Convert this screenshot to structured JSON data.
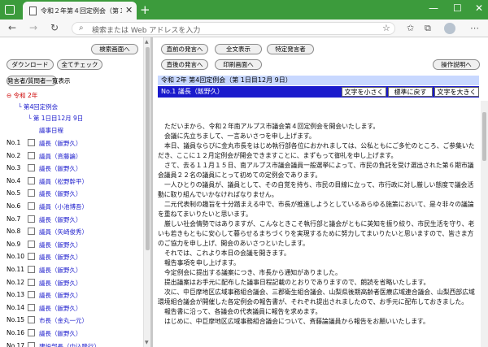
{
  "browser": {
    "tab_title": "令和２年第４回定例会（第１日目",
    "tab_close": "✕",
    "new_tab": "+",
    "back": "←",
    "forward": "→",
    "reload": "↻",
    "address_placeholder": "検索または Web アドレスを入力",
    "minimize": "—",
    "maximize": "☐",
    "close": "✕"
  },
  "left": {
    "buttons": {
      "search_screen": "検索画面へ",
      "download": "ダウンロード",
      "all_check": "全てチェック",
      "speaker_list": "発言者/質問者一覧表示"
    },
    "tree": {
      "year": "令和 2年",
      "session": "第4回定例会",
      "day": "第 1日目12月 9日",
      "agenda": "議事日程"
    },
    "rows": [
      {
        "no": "No.1",
        "speaker": "議長（飯野久）"
      },
      {
        "no": "No.2",
        "speaker": "議員（斉藤論）"
      },
      {
        "no": "No.3",
        "speaker": "議長（飯野久）"
      },
      {
        "no": "No.4",
        "speaker": "議員（松野幹平）"
      },
      {
        "no": "No.5",
        "speaker": "議長（飯野久）"
      },
      {
        "no": "No.6",
        "speaker": "議員（小池博吾）"
      },
      {
        "no": "No.7",
        "speaker": "議長（飯野久）"
      },
      {
        "no": "No.8",
        "speaker": "議員（矢崎俊秀）"
      },
      {
        "no": "No.9",
        "speaker": "議長（飯野久）"
      },
      {
        "no": "No.10",
        "speaker": "議長（飯野久）"
      },
      {
        "no": "No.11",
        "speaker": "議長（飯野久）"
      },
      {
        "no": "No.12",
        "speaker": "議長（飯野久）"
      },
      {
        "no": "No.13",
        "speaker": "議長（飯野久）"
      },
      {
        "no": "No.14",
        "speaker": "議長（飯野久）"
      },
      {
        "no": "No.15",
        "speaker": "市長（金丸一元）"
      },
      {
        "no": "No.16",
        "speaker": "議長（飯野久）"
      },
      {
        "no": "No.17",
        "speaker": "建設部長（中込隆行）"
      }
    ]
  },
  "right": {
    "buttons": {
      "prev_remark": "直前の発言へ",
      "full_text": "全文表示",
      "specific_speaker": "特定発言者",
      "next_remark": "直後の発言へ",
      "print_screen": "印刷画面へ",
      "operation_help": "操作説明へ"
    },
    "meeting_title": "令和 2年 第4回定例会（第 1日目12月 9日）",
    "speaker_label": "No.1 議長（飯野久）",
    "size_buttons": {
      "smaller": "文字を小さく",
      "standard": "標準に戻す",
      "larger": "文字を大きく"
    },
    "paragraphs": [
      "ただいまから、令和２年南アルプス市議会第４回定例会を開会いたします。",
      "会議に先立ちまして、一言あいさつを申し上げます。",
      "本日、議員ならびに金丸市長をはじめ執行部各位におかれましては、公私ともにご多忙のところ、ご参集いただき、ここに１２月定例会が開会できますことに、まずもって御礼を申し上げます。",
      "さて、去る１１月１５日、南アルプス市議会議員一般選挙によって、市民の負託を受け選出された第６期市議会議員２２名の議員にとって初めての定例会であります。",
      "一人ひとりの議員が、議員として、その自覚を持ち、市民の目線に立って、市行政に対し厳しい態度で議会活動に取り組んでいかなければなりません。",
      "二元代表制の趣旨を十分踏まえる中で、市長が推進しようとしているあらゆる施策において、是々非々の議論を重ねてまいりたいと思います。",
      "厳しい社会情勢ではありますが、こんなときこそ執行部と議会がともに英知を振り絞り、市民生活を守り、老いも若きもともに安心して暮らせるまちづくりを実現するために努力してまいりたいと思いますので、皆さま方のご協力を申し上げ、開会のあいさつといたします。",
      "それでは、これより本日の会議を開きます。",
      "報告事項を申し上げます。",
      "今定例会に提出する議案につき、市長から通知がありました。",
      "提出議案はお手元に配布した議事日程記載のとおりでありますので、朗読を省略いたします。",
      "次に、中巨摩地区広域事務組合議会、三郡衛生組合議会、山梨県後期高齢者医療広域連合議会、山梨西部広域環境組合議会が開催した各定例会の報告書が、それぞれ提出されましたので、お手元に配布しておきました。",
      "報告書に沿って、各議会の代表議員に報告を求めます。",
      "はじめに、中巨摩地区広域事務組合議会について、斉藤論議員から報告をお願いいたします。"
    ]
  }
}
